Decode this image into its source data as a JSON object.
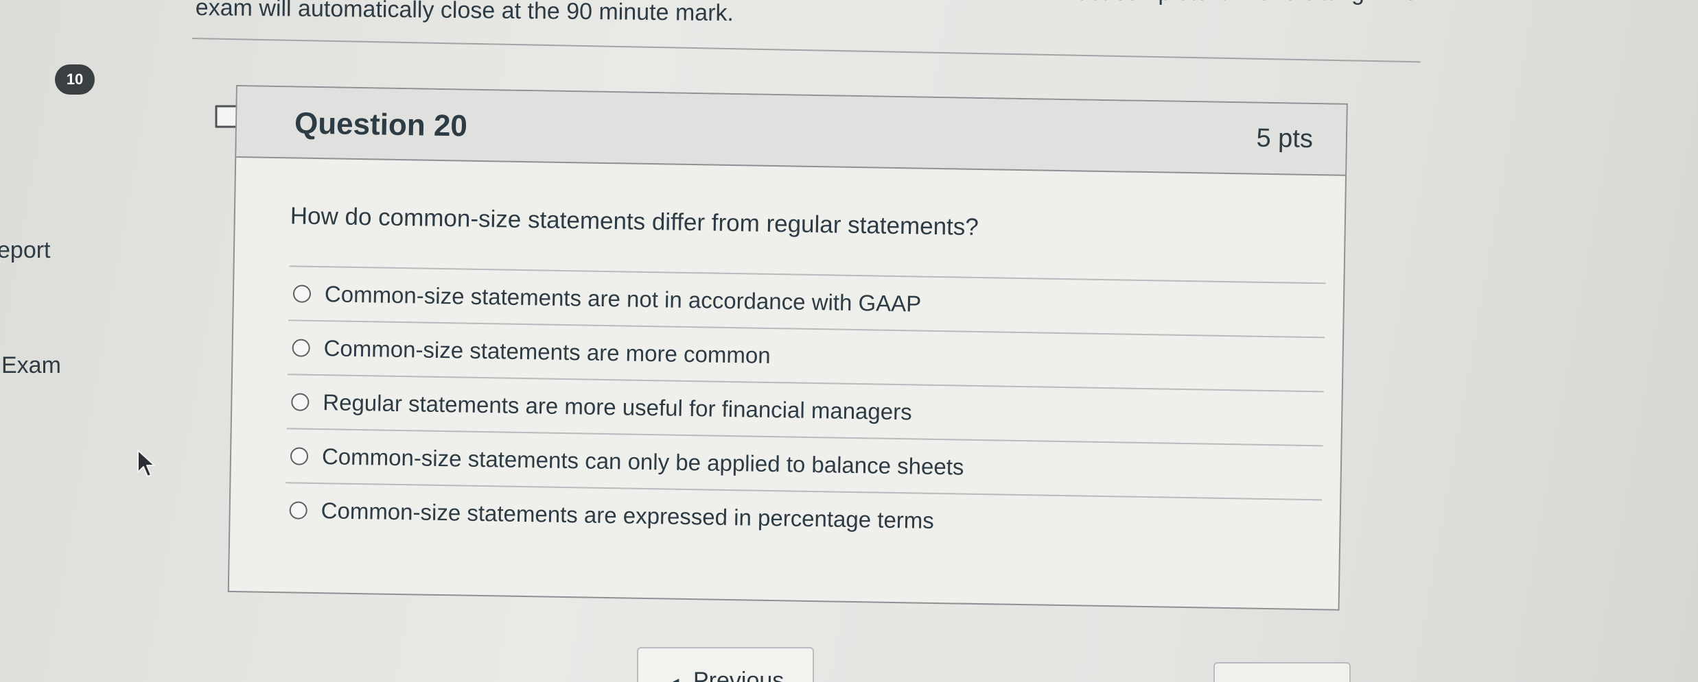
{
  "page": {
    "instructions_line_1": "exam will automatically close at the 90 minute mark.",
    "instructions_fragment_right": "must complete it in one sitting. The"
  },
  "sidebar": {
    "badge_count": "10",
    "link_report": "eport",
    "link_exam": "Exam"
  },
  "question": {
    "title": "Question 20",
    "points": "5 pts",
    "text": "How do common-size statements differ from regular statements?",
    "answers": [
      {
        "label": "Common-size statements are not in accordance with GAAP"
      },
      {
        "label": "Common-size statements are more common"
      },
      {
        "label": "Regular statements are more useful for financial managers"
      },
      {
        "label": "Common-size statements can only be applied to balance sheets"
      },
      {
        "label": "Common-size statements are expressed in percentage terms"
      }
    ]
  },
  "navigation": {
    "previous_label": "Previous",
    "previous_arrow": "◀"
  },
  "icons": {
    "flag": "flag-icon",
    "cursor": "mouse-cursor-icon"
  },
  "colors": {
    "text": "#2d3b45",
    "badge_bg": "#3a3f42",
    "card_bg": "#efefec",
    "header_bg": "#e0e1de",
    "border": "#8c9194"
  }
}
